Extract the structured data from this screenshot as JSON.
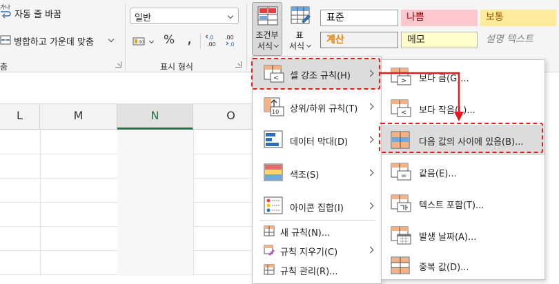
{
  "ribbon": {
    "align": {
      "wrap_icon_label": "가나",
      "wrap_label": "자동 줄 바꿈",
      "merge_label": "병합하고 가운데 맞춤",
      "group_label_partial": "춤"
    },
    "number": {
      "format_value": "일반",
      "percent": "%",
      "comma": ",",
      "inc_decimal": "←.0\n.00",
      "dec_decimal": ".00\n→.0",
      "group_label": "표시 형식"
    },
    "conditional_format": {
      "line1": "조건부",
      "line2": "서식"
    },
    "format_table": {
      "line1": "표",
      "line2": "서식"
    },
    "styles": {
      "normal": "표준",
      "bad": "나쁨",
      "neutral": "보통",
      "calculation": "계산",
      "note": "메모",
      "explanatory": "설명 텍스트"
    }
  },
  "sheet": {
    "columns": [
      "L",
      "M",
      "N",
      "O"
    ],
    "selected_column": "N"
  },
  "menu": {
    "items": [
      {
        "label": "셀 강조 규칙(H)",
        "has_submenu": true
      },
      {
        "label": "상위/하위 규칙(T)",
        "has_submenu": true
      },
      {
        "label": "데이터 막대(D)",
        "has_submenu": true
      },
      {
        "label": "색조(S)",
        "has_submenu": true
      },
      {
        "label": "아이콘 집합(I)",
        "has_submenu": true
      },
      {
        "label": "새 규칙(N)..."
      },
      {
        "label": "규칙 지우기(C)",
        "has_submenu": true
      },
      {
        "label": "규칙 관리(R)..."
      }
    ]
  },
  "submenu": {
    "items": [
      {
        "label": "보다 큼(G)..."
      },
      {
        "label": "보다 작음(L)..."
      },
      {
        "label": "다음 값의 사이에 있음(B)..."
      },
      {
        "label": "같음(E)..."
      },
      {
        "label": "텍스트 포함(T)..."
      },
      {
        "label": "발생 날짜(A)..."
      },
      {
        "label": "중복 값(D)..."
      }
    ]
  },
  "colors": {
    "highlight_red": "#e21c1c",
    "excel_green": "#217346",
    "bad_fill": "#ffc7ce",
    "bad_text": "#9c0006",
    "neutral_fill": "#ffeb9c",
    "neutral_text": "#9c5700",
    "calc_fill": "#f2f2f2",
    "calc_text": "#fa7d00",
    "note_fill": "#ffffcc"
  }
}
